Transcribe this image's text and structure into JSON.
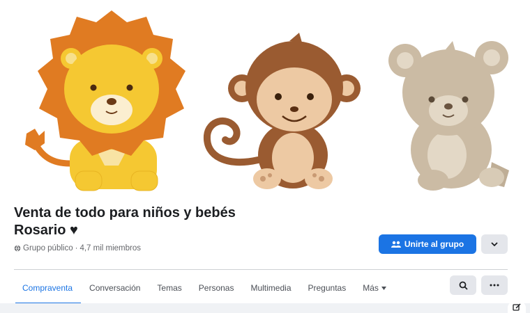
{
  "group": {
    "name": "Venta de todo para niños y bebés Rosario ♥",
    "privacy": "Grupo público",
    "separator": "·",
    "members": "4,7 mil miembros"
  },
  "actions": {
    "join_label": "Unirte al grupo"
  },
  "tabs": [
    {
      "label": "Compraventa"
    },
    {
      "label": "Conversación"
    },
    {
      "label": "Temas"
    },
    {
      "label": "Personas"
    },
    {
      "label": "Multimedia"
    },
    {
      "label": "Preguntas"
    },
    {
      "label": "Más"
    }
  ],
  "icons": {
    "globe": "globe-icon",
    "join": "group-join-icon",
    "dropdown": "chevron-down-icon",
    "search": "search-icon",
    "more": "more-dots-icon",
    "edit": "edit-icon"
  },
  "colors": {
    "accent": "#1b74e4",
    "button_gray": "#e4e6eb",
    "lion_mane": "#e07b22",
    "lion_face": "#f5c832",
    "monkey_brown": "#9a5b31",
    "monkey_face": "#edc9a3",
    "bear_tan": "#cbbba4"
  }
}
